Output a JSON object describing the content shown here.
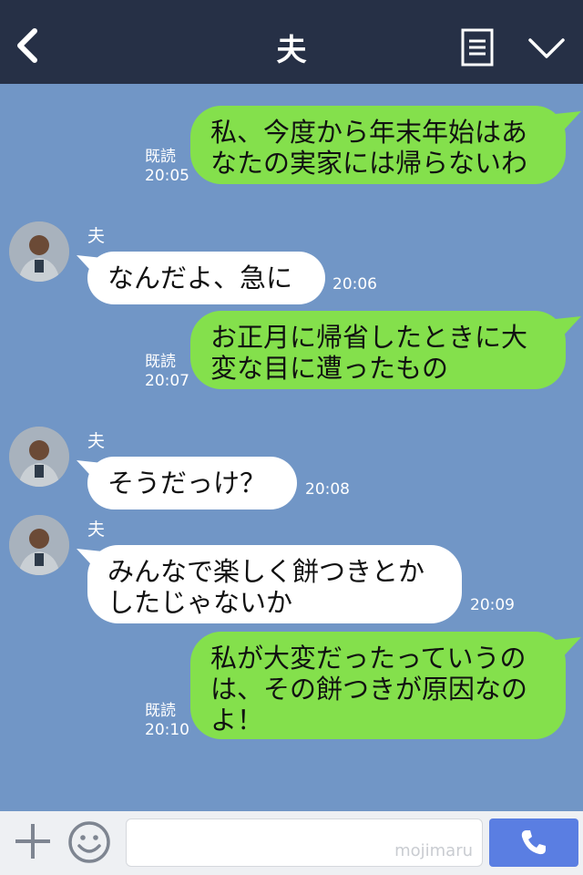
{
  "header": {
    "title": "夫"
  },
  "messages": [
    {
      "side": "me",
      "lines": [
        "私、今度から年末年始はあ",
        "なたの実家には帰らないわ"
      ],
      "read": "既読",
      "time": "20:05"
    },
    {
      "side": "them",
      "sender": "夫",
      "lines": [
        "なんだよ、急に"
      ],
      "time": "20:06"
    },
    {
      "side": "me",
      "lines": [
        "お正月に帰省したときに大",
        "変な目に遭ったもの"
      ],
      "read": "既読",
      "time": "20:07"
    },
    {
      "side": "them",
      "sender": "夫",
      "lines": [
        "そうだっけ？"
      ],
      "time": "20:08"
    },
    {
      "side": "them",
      "sender": "夫",
      "lines": [
        "みんなで楽しく餅つきとか",
        "したじゃないか"
      ],
      "time": "20:09"
    },
    {
      "side": "me",
      "lines": [
        "私が大変だったっていうの",
        "は、その餅つきが原因なの",
        "よ！"
      ],
      "read": "既読",
      "time": "20:10"
    }
  ],
  "footer": {
    "input_value": "",
    "watermark": "mojimaru"
  },
  "colors": {
    "header": "#263046",
    "background": "#7196c6",
    "my_bubble": "#84e04c",
    "their_bubble": "#ffffff",
    "call_button": "#5a7ee2"
  },
  "icons": [
    "back-icon",
    "menu-icon",
    "chevron-down-icon",
    "plus-icon",
    "smiley-icon",
    "phone-icon"
  ]
}
